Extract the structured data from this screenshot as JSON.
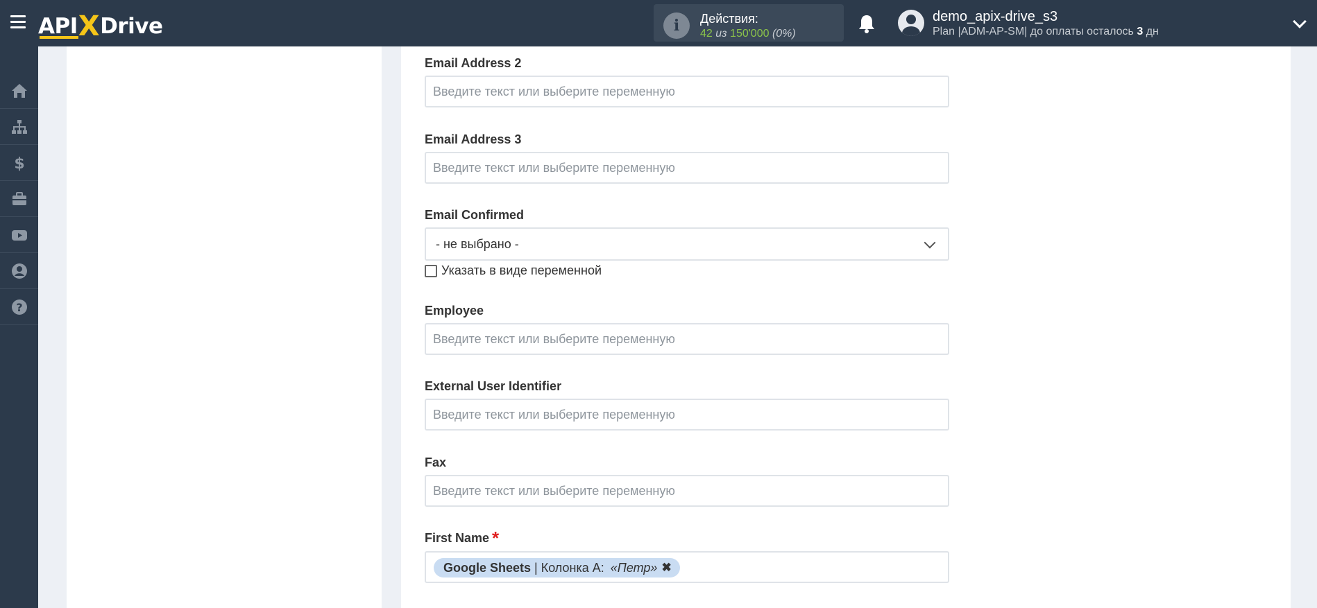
{
  "header": {
    "logo": {
      "api": "API",
      "x": "X",
      "drive": "Drive"
    },
    "actions": {
      "label": "Действия:",
      "used": "42",
      "of": "из",
      "total": "150'000",
      "percent": "(0%)"
    },
    "user": {
      "name": "demo_apix-drive_s3",
      "plan_prefix": "Plan |ADM-AP-SM| до оплаты осталось",
      "days": "3",
      "days_suffix": "дн"
    }
  },
  "sidebar": {
    "items": [
      {
        "icon": "home-icon"
      },
      {
        "icon": "sitemap-icon"
      },
      {
        "icon": "dollar-icon"
      },
      {
        "icon": "briefcase-icon"
      },
      {
        "icon": "youtube-icon"
      },
      {
        "icon": "user-circle-icon"
      },
      {
        "icon": "question-icon"
      }
    ]
  },
  "form": {
    "placeholder": "Введите текст или выберите переменную",
    "fields": [
      {
        "label": "Email Address 2"
      },
      {
        "label": "Email Address 3"
      },
      {
        "label": "Email Confirmed",
        "select_value": "- не выбрано -",
        "checkbox_label": "Указать в виде переменной"
      },
      {
        "label": "Employee"
      },
      {
        "label": "External User Identifier"
      },
      {
        "label": "Fax"
      },
      {
        "label": "First Name",
        "required": "*",
        "tag": {
          "source": "Google Sheets",
          "separator": " | Колонка A: ",
          "value": "«Петр»",
          "remove": "✖"
        }
      }
    ]
  }
}
